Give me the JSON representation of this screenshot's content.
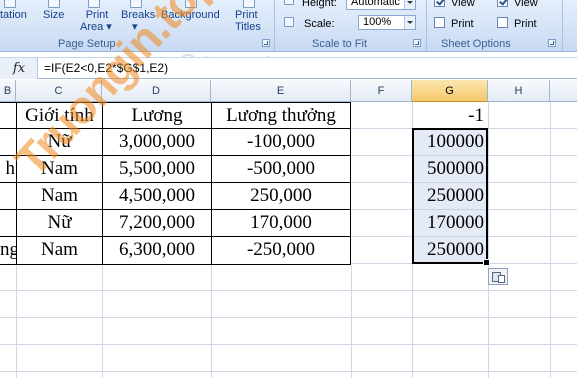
{
  "ribbon": {
    "buttons": {
      "orientation": "tation",
      "size": "Size",
      "print_area": "Print\nArea",
      "breaks": "Breaks",
      "background": "Background",
      "print_titles": "Print\nTitles"
    },
    "dropdown_markers": {
      "print_area": "▾",
      "breaks": "▾"
    },
    "groups": {
      "page_setup": "Page Setup",
      "scale_to_fit": "Scale to Fit",
      "sheet_options": "Sheet Options"
    },
    "height_label": "Height:",
    "height_value": "Automatic",
    "scale_label": "Scale:",
    "scale_value": "100%",
    "gridlines_view_label": "View",
    "gridlines_print_label": "Print",
    "headings_view_label": "View",
    "headings_print_label": "Print",
    "gridlines_view_checked": true,
    "gridlines_print_checked": false,
    "headings_view_checked": true,
    "headings_print_checked": false
  },
  "formula_bar": {
    "fx_label": "fx",
    "formula": "=IF(E2<0,E2*$G$1,E2)"
  },
  "grid": {
    "columns": [
      "B",
      "C",
      "D",
      "E",
      "F",
      "G",
      "H"
    ],
    "active_column": "G",
    "header_row": {
      "gioi_tinh": "Giới tính",
      "luong": "Lương",
      "luong_thuong": "Lương thưởng",
      "g1": "-1"
    },
    "rows": [
      {
        "b": "",
        "gioi_tinh": "Nữ",
        "luong": "3,000,000",
        "luong_thuong": "-100,000",
        "g": "100000"
      },
      {
        "b": "h",
        "gioi_tinh": "Nam",
        "luong": "5,500,000",
        "luong_thuong": "-500,000",
        "g": "500000"
      },
      {
        "b": "",
        "gioi_tinh": "Nam",
        "luong": "4,500,000",
        "luong_thuong": "250,000",
        "g": "250000"
      },
      {
        "b": "",
        "gioi_tinh": "Nữ",
        "luong": "7,200,000",
        "luong_thuong": "170,000",
        "g": "170000"
      },
      {
        "b": "ng",
        "gioi_tinh": "Nam",
        "luong": "6,300,000",
        "luong_thuong": "-250,000",
        "g": "250000"
      }
    ]
  },
  "watermarks": {
    "main": "Truongin.top",
    "secondary": "Quantrimang"
  },
  "colors": {
    "ribbon_text": "#15428b",
    "active_header": "#f6c86a",
    "selection_fill": "#b2c5e4",
    "watermark": "#f28a1e"
  }
}
